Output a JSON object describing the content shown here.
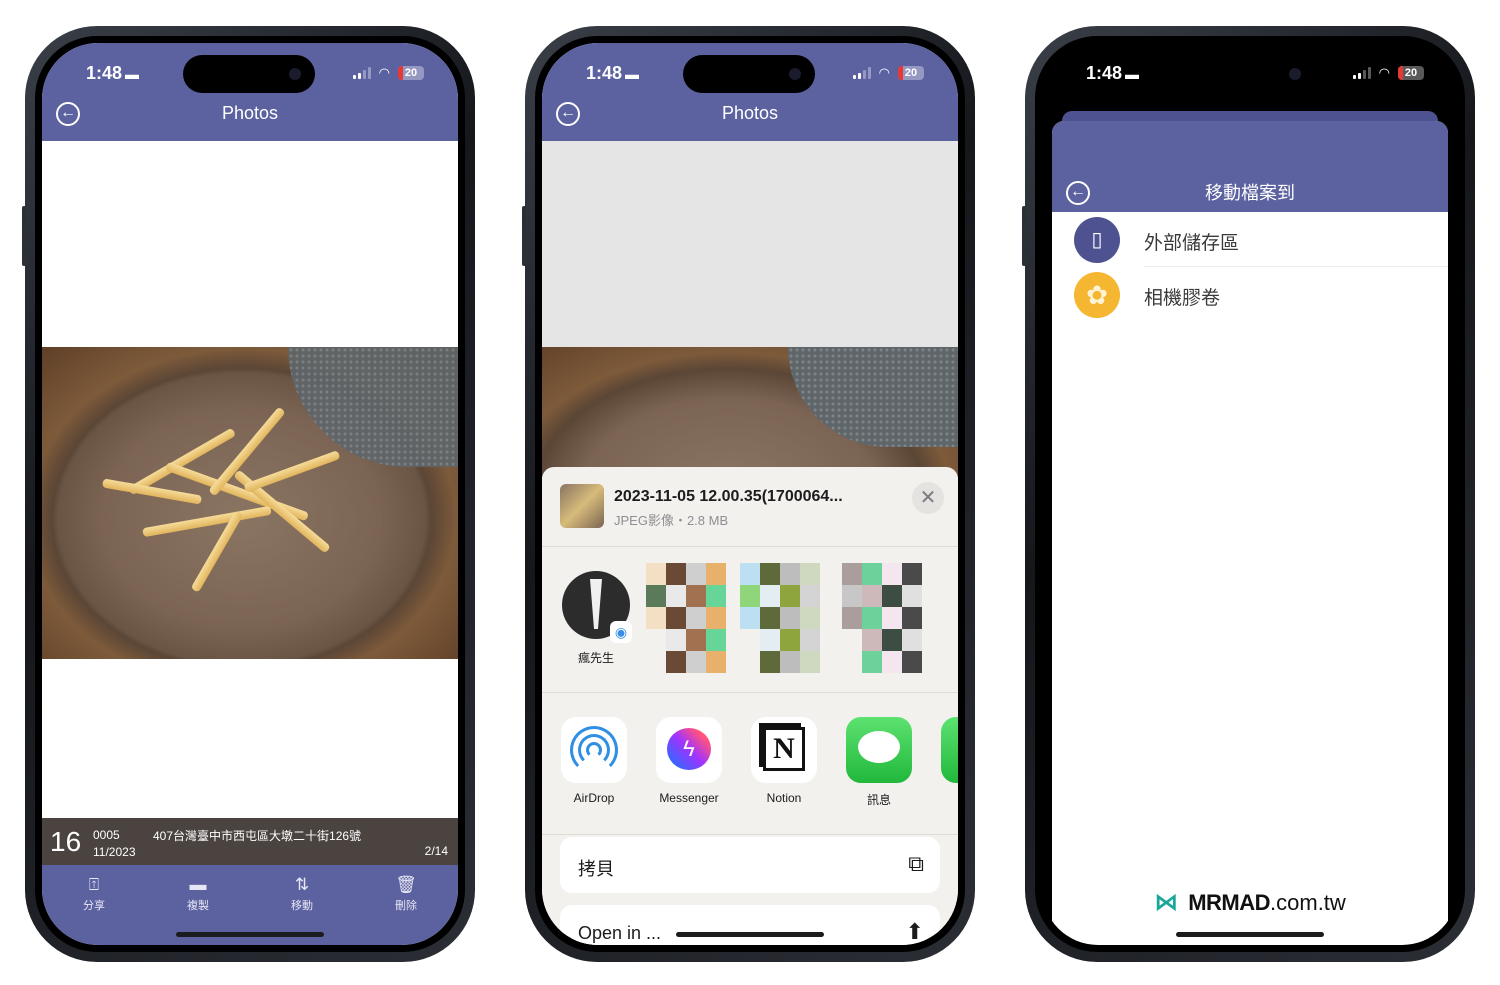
{
  "status": {
    "time": "1:48",
    "battery": "20"
  },
  "phone1": {
    "title": "Photos",
    "info": {
      "day": "16",
      "code": "0005",
      "month_year": "11/2023",
      "address": "407台灣臺中市西屯區大墩二十街126號",
      "page": "2/14"
    },
    "toolbar": [
      {
        "icon": "share-icon",
        "glyph": "⍐",
        "label": "分享"
      },
      {
        "icon": "copy-icon",
        "glyph": "▬",
        "label": "複製"
      },
      {
        "icon": "move-icon",
        "glyph": "⇅",
        "label": "移動"
      },
      {
        "icon": "trash-icon",
        "glyph": "🗑",
        "label": "刪除"
      }
    ]
  },
  "phone2": {
    "title": "Photos",
    "share_sheet": {
      "file_name": "2023-11-05 12.00.35(1700064...",
      "file_meta": "JPEG影像・2.8 MB",
      "close": "✕",
      "person": {
        "name": "瘋先生"
      },
      "apps": [
        {
          "name": "airdrop",
          "label": "AirDrop"
        },
        {
          "name": "messenger",
          "label": "Messenger"
        },
        {
          "name": "notion",
          "label": "Notion",
          "glyph": "N"
        },
        {
          "name": "messages",
          "label": "訊息"
        }
      ],
      "actions": [
        {
          "label": "拷貝",
          "icon": "⧉"
        },
        {
          "label": "Open in ...",
          "icon": "⬆"
        }
      ]
    }
  },
  "phone3": {
    "title": "移動檔案到",
    "destinations": [
      {
        "label": "外部儲存區",
        "color": "#4e5290"
      },
      {
        "label": "相機膠卷",
        "color": "#f5b731"
      }
    ],
    "brand": {
      "main": "MRMAD",
      "suffix": ".com.tw"
    }
  },
  "colors": {
    "appbar": "#5c61a0",
    "infobar": "#4a4340",
    "brand": "#1aa79a"
  }
}
